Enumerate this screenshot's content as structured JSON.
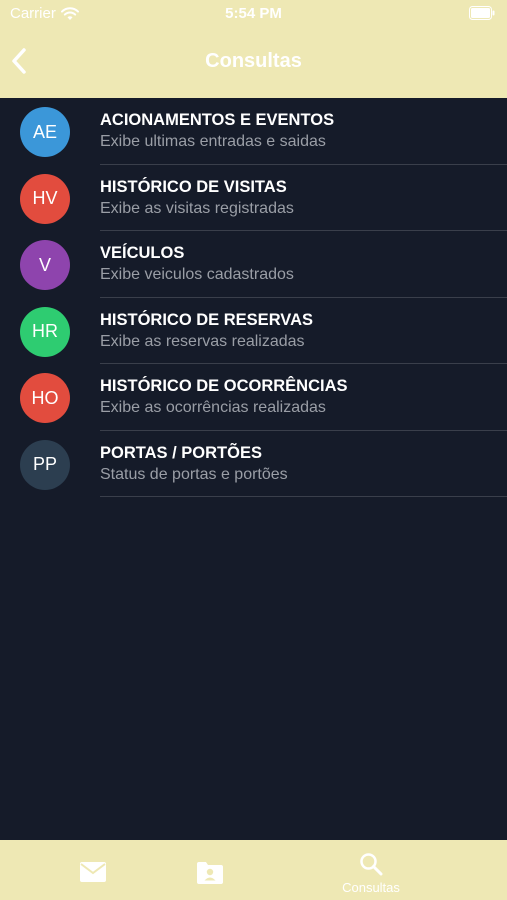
{
  "status_bar": {
    "carrier": "Carrier",
    "time": "5:54 PM"
  },
  "nav": {
    "title": "Consultas",
    "back_icon": "chevron-left-icon"
  },
  "items": [
    {
      "initials": "AE",
      "color": "#3b97d9",
      "title": "ACIONAMENTOS E EVENTOS",
      "subtitle": "Exibe ultimas entradas e saidas"
    },
    {
      "initials": "HV",
      "color": "#e24c3e",
      "title": "HISTÓRICO DE VISITAS",
      "subtitle": "Exibe as visitas registradas"
    },
    {
      "initials": "V",
      "color": "#8e44ad",
      "title": "VEÍCULOS",
      "subtitle": "Exibe veiculos cadastrados"
    },
    {
      "initials": "HR",
      "color": "#2ecc71",
      "title": "HISTÓRICO DE RESERVAS",
      "subtitle": "Exibe as reservas realizadas"
    },
    {
      "initials": "HO",
      "color": "#e24c3e",
      "title": "HISTÓRICO DE OCORRÊNCIAS",
      "subtitle": "Exibe as ocorrências realizadas"
    },
    {
      "initials": "PP",
      "color": "#2c3e50",
      "title": "PORTAS / PORTÕES",
      "subtitle": "Status de portas e portões"
    }
  ],
  "tab_bar": {
    "tabs": [
      {
        "icon": "mail-icon",
        "label": ""
      },
      {
        "icon": "contacts-folder-icon",
        "label": ""
      },
      {
        "icon": "search-icon",
        "label": "Consultas",
        "selected": true
      }
    ]
  },
  "colors": {
    "header_background": "#eee8b4",
    "page_background": "#151b29",
    "separator": "#3a3f4b",
    "subtitle_text": "#9a9ea6"
  }
}
